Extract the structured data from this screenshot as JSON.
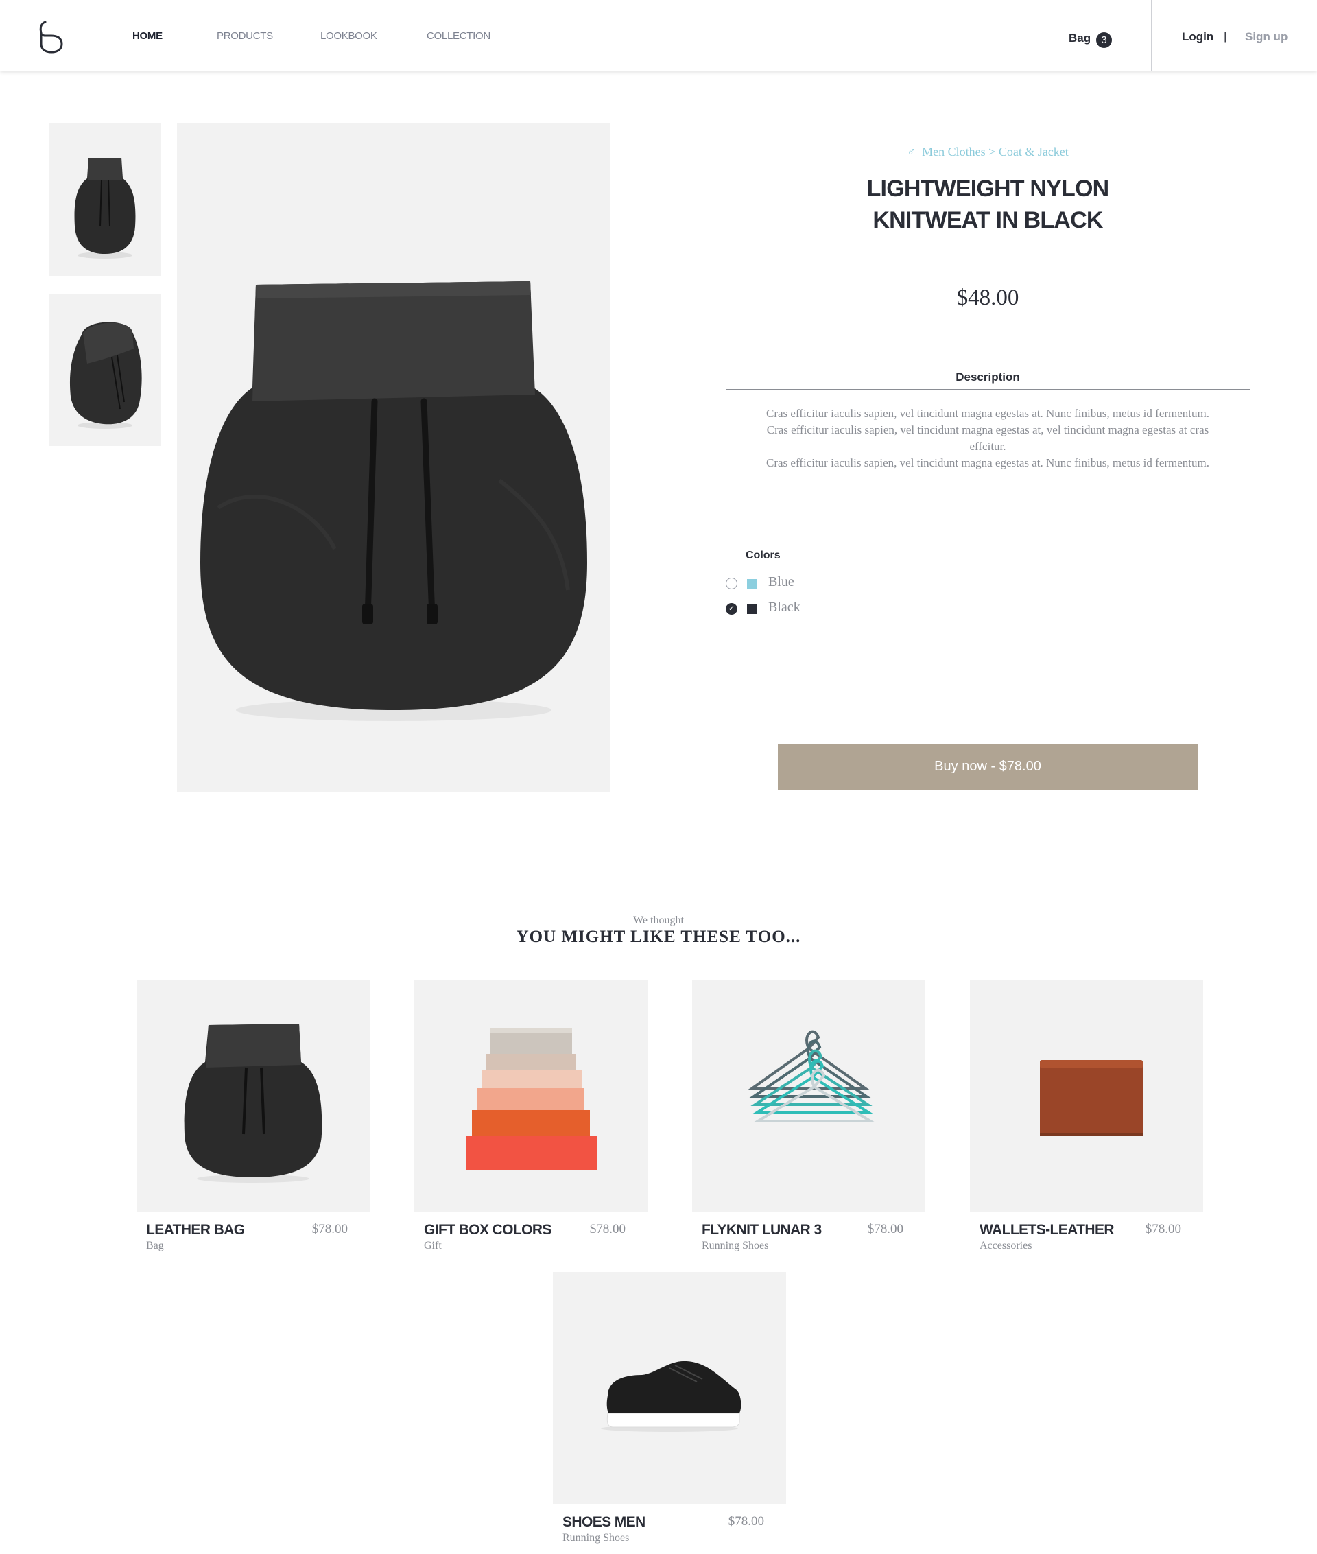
{
  "header": {
    "nav": [
      {
        "label": "HOME"
      },
      {
        "label": "PRODUCTS"
      },
      {
        "label": "LOOKBOOK"
      },
      {
        "label": "COLLECTION"
      }
    ],
    "bag_label": "Bag",
    "bag_count": "3",
    "login": "Login",
    "separator": "|",
    "signup": "Sign up"
  },
  "product": {
    "breadcrumb": {
      "category": "Men Clothes",
      "separator": ">",
      "subcategory": "Coat & Jacket"
    },
    "title_lines": [
      "LIGHTWEIGHT NYLON",
      "KNITWEAT IN BLACK"
    ],
    "price": "$48.00",
    "description_label": "Description",
    "description_lines": [
      "Cras efficitur iaculis sapien, vel tincidunt magna egestas at. Nunc finibus, metus id fermentum.",
      "Cras efficitur iaculis sapien, vel tincidunt magna egestas at, vel tincidunt magna egestas at cras",
      "effcitur.",
      "Cras efficitur iaculis sapien, vel tincidunt magna egestas at. Nunc finibus, metus id fermentum."
    ],
    "colors_label": "Colors",
    "colors": [
      {
        "name": "Blue",
        "swatch": "#8ccfdf",
        "selected": false
      },
      {
        "name": "Black",
        "swatch": "#2a2d36",
        "selected": true
      }
    ],
    "buy_button": "Buy now - $78.00"
  },
  "recommendations": {
    "kicker": "We thought",
    "heading": "YOU MIGHT LIKE THESE TOO...",
    "items": [
      {
        "name": "LEATHER BAG",
        "category": "Bag",
        "price": "$78.00"
      },
      {
        "name": "GIFT BOX COLORS",
        "category": "Gift",
        "price": "$78.00"
      },
      {
        "name": "FLYKNIT LUNAR 3",
        "category": "Running Shoes",
        "price": "$78.00"
      },
      {
        "name": "WALLETS-LEATHER",
        "category": "Accessories",
        "price": "$78.00"
      },
      {
        "name": "SHOES MEN",
        "category": "Running Shoes",
        "price": "$78.00"
      }
    ]
  },
  "colors": {
    "accent_blue": "#8ccbdb",
    "button": "#b0a493",
    "text_dark": "#2a2d36",
    "text_muted": "#8a8d94"
  }
}
